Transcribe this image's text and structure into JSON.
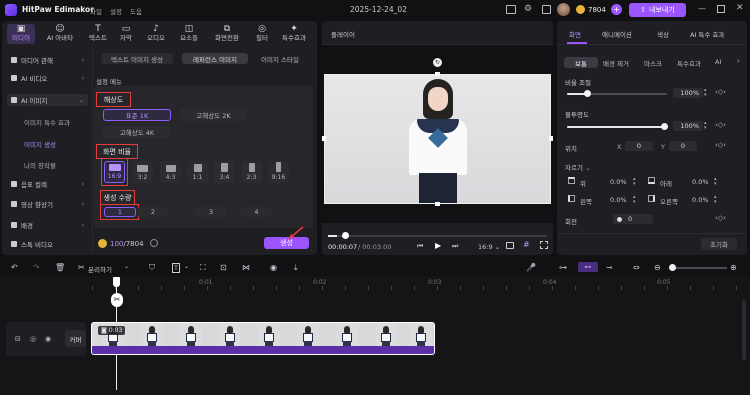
{
  "titlebar": {
    "app_name": "HitPaw Edimakor",
    "menu": [
      "파일",
      "설정",
      "도움"
    ],
    "project_title": "2025-12-24_02",
    "credits": "7804",
    "upgrade_label": "내보내기"
  },
  "toolbar": {
    "tools": [
      {
        "label": "미디어",
        "icon": "media-icon"
      },
      {
        "label": "AI 아바타",
        "icon": "ai-avatar-icon"
      },
      {
        "label": "텍스트",
        "icon": "text-icon"
      },
      {
        "label": "자막",
        "icon": "subtitle-icon"
      },
      {
        "label": "오디오",
        "icon": "audio-icon"
      },
      {
        "label": "요소들",
        "icon": "elements-icon"
      },
      {
        "label": "화면전환",
        "icon": "transition-icon"
      },
      {
        "label": "필터",
        "icon": "filter-icon"
      },
      {
        "label": "특수효과",
        "icon": "effects-icon"
      }
    ]
  },
  "sidebar": {
    "items": [
      {
        "label": "미디어 관해",
        "expanded": false
      },
      {
        "label": "AI 비디오",
        "expanded": false
      },
      {
        "label": "AI 이미지",
        "expanded": true
      }
    ],
    "sub_items": [
      "이미지 특수 효과",
      "이미지 생성",
      "나의 창작물"
    ],
    "items_bottom": [
      {
        "label": "음표 컬렉",
        "expanded": false
      },
      {
        "label": "영상 향상기",
        "expanded": false
      },
      {
        "label": "배경",
        "expanded": false
      },
      {
        "label": "스톡 비디오",
        "expanded": false
      }
    ]
  },
  "image_gen": {
    "tabs": [
      "텍스트 이미지 생성",
      "레퍼런스 이미지",
      "이미지 스타일"
    ],
    "active_tab": 1,
    "settings_title": "설정 메뉴",
    "resolution_label": "해상도",
    "resolutions": [
      "표준 1K",
      "고해상도 2K",
      "고해상도 4K"
    ],
    "ratio_label": "화면 비율",
    "ratios": [
      "16:9",
      "3:2",
      "4:3",
      "1:1",
      "3:4",
      "2:3",
      "9:16"
    ],
    "count_label": "생성 수량",
    "counts": [
      "1",
      "2",
      "3",
      "4"
    ],
    "credit_used": "100",
    "credit_total": "/7804",
    "generate_label": "생성"
  },
  "player": {
    "title": "플레이어",
    "current_time": "00:00:07",
    "total_time": "/ 00:03:00",
    "aspect": "16:9",
    "progress": 0.04
  },
  "properties": {
    "tabs": [
      "화면",
      "애니메이션",
      "색상",
      "AI 특수 효과"
    ],
    "subtabs": [
      "보통",
      "배경 제거",
      "마스크",
      "특수효과",
      "AI"
    ],
    "scale_label": "비율 조절",
    "scale_value": "100%",
    "scale_level": 1.0,
    "opacity_label": "불투명도",
    "opacity_value": "100%",
    "opacity_level": 1.0,
    "position_label": "위치",
    "x_label": "X",
    "x_value": "0",
    "y_label": "Y",
    "y_value": "0",
    "crop_label": "자르기",
    "crop_top_label": "위",
    "crop_top": "0.0%",
    "crop_bottom_label": "아래",
    "crop_bottom": "0.0%",
    "crop_left_label": "왼쪽",
    "crop_left": "0.0%",
    "crop_right_label": "오른쪽",
    "crop_right": "0.0%",
    "rotation_label": "회전",
    "rotation_value": "0",
    "reset_label": "초기화"
  },
  "timeline": {
    "split_label": "분리하기",
    "ruler": [
      "0:01",
      "0:02",
      "0:03",
      "0:04",
      "0:05"
    ],
    "track_label": "커버",
    "clip_duration": "0:03"
  }
}
